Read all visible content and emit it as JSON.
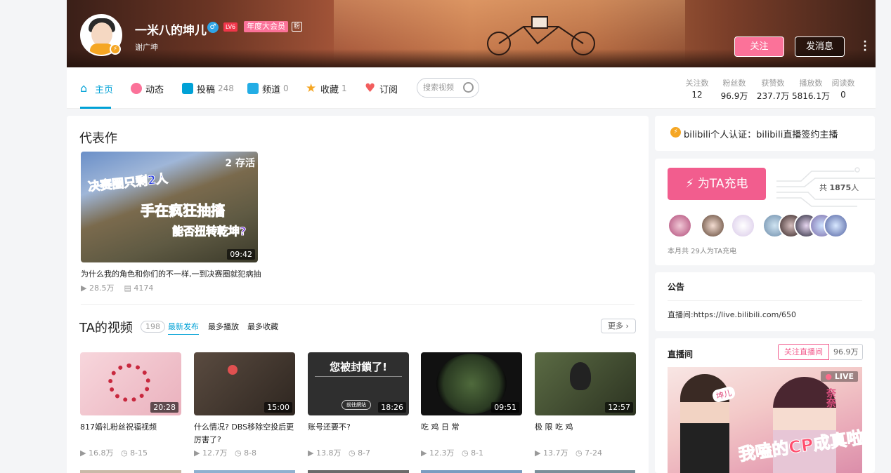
{
  "profile": {
    "username": "一米八的坤儿",
    "gender_symbol": "♂",
    "level": "LV6",
    "vip": "年度大会员",
    "vip_extra": "粉",
    "signature": "谢广坤",
    "follow_btn": "关注",
    "message_btn": "发消息"
  },
  "nav": {
    "home": "主页",
    "dynamic": "动态",
    "posts": "投稿",
    "posts_count": "248",
    "channels": "频道",
    "channels_count": "0",
    "favorites": "收藏",
    "favorites_count": "1",
    "subscribe": "订阅",
    "search_placeholder": "搜索视频"
  },
  "stats": [
    {
      "label": "关注数",
      "value": "12"
    },
    {
      "label": "粉丝数",
      "value": "96.9万"
    },
    {
      "label": "获赞数",
      "value": "237.7万"
    },
    {
      "label": "播放数",
      "value": "5816.1万"
    },
    {
      "label": "阅读数",
      "value": "0"
    }
  ],
  "representative": {
    "heading": "代表作",
    "thumb_text1": "决赛圈只剩2人",
    "thumb_text2": "手在疯狂抽搐",
    "thumb_text3": "能否扭转乾坤?",
    "thumb_tag": "2 存活",
    "duration": "09:42",
    "title": "为什么我的角色和你们的不一样,一到决赛圈就犯病抽",
    "plays": "28.5万",
    "danmaku": "4174"
  },
  "videos_section": {
    "heading": "TA的视频",
    "count": "198",
    "tabs": [
      "最新发布",
      "最多播放",
      "最多收藏"
    ],
    "more": "更多"
  },
  "videos": [
    {
      "title": "817婚礼粉丝祝福视频",
      "title2": "",
      "duration": "20:28",
      "plays": "16.8万",
      "date": "8-15",
      "bg": "#f2c4cc"
    },
    {
      "title": "什么情况? DBS移除空投后更",
      "title2": "厉害了?",
      "duration": "15:00",
      "plays": "12.7万",
      "date": "8-8",
      "bg": "#4a4038"
    },
    {
      "title": "账号还要不?",
      "title2": "",
      "duration": "18:26",
      "plays": "13.8万",
      "date": "8-7",
      "bg": "#2f2f2f",
      "overlay": "您被封鎖了!",
      "btn": "前往網站"
    },
    {
      "title": "吃 鸡 日 常",
      "title2": "",
      "duration": "09:51",
      "plays": "12.3万",
      "date": "8-1",
      "bg": "#1f2a20"
    },
    {
      "title": "极 限 吃 鸡",
      "title2": "",
      "duration": "12:57",
      "plays": "13.7万",
      "date": "7-24",
      "bg": "#3d4a30"
    }
  ],
  "sidebar": {
    "certification": "bilibili个人认证：bilibili直播签约主播",
    "charge_btn": "为TA充电",
    "charge_total_prefix": "共",
    "charge_total": "1875",
    "charge_total_suffix": "人",
    "charge_month": "本月共 29人为TA充电",
    "notice_heading": "公告",
    "notice_text": "直播间:https://live.bilibili.com/650",
    "live_heading": "直播间",
    "live_follow": "关注直播间",
    "live_count": "96.9万",
    "live_badge": "LIVE",
    "live_art_text": "我嗑的CP成真啦!",
    "live_tag1": "坤儿",
    "live_tag2": "奈奈"
  },
  "colors": {
    "accent": "#00a1d6",
    "pink": "#fb7299",
    "charge": "#f25d8e"
  }
}
